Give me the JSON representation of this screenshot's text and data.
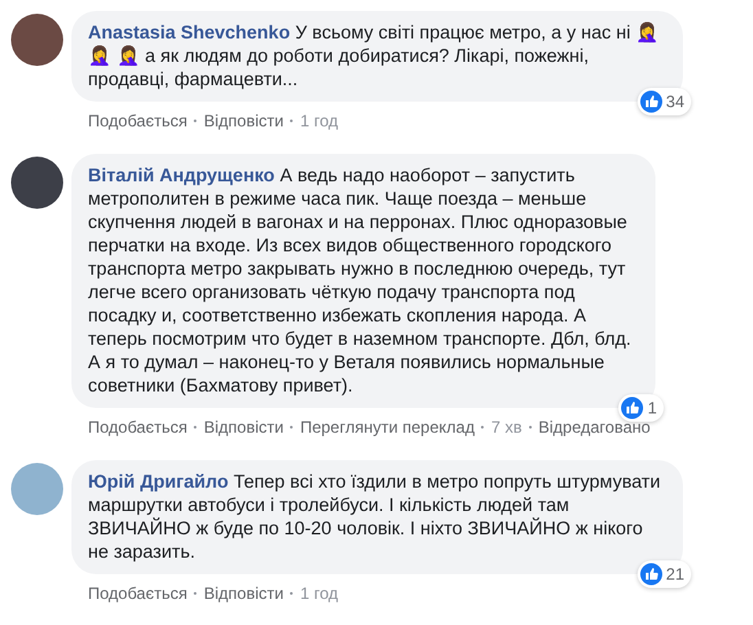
{
  "comments": [
    {
      "author": "Anastasia Shevchenko",
      "text": "У всьому світі працює метро, а у нас ні 🤦‍♀️ 🤦‍♀️ 🤦‍♀️ а як людям до роботи добиратися? Лікарі, пожежні, продавці, фармацевти...",
      "likes": "34",
      "actions": [
        {
          "label": "Подобається",
          "kind": "link"
        },
        {
          "label": "Відповісти",
          "kind": "link"
        },
        {
          "label": "1 год",
          "kind": "time"
        }
      ]
    },
    {
      "author": "Віталій Андрущенко",
      "text": "А ведь надо наоборот – запустить метрополитен в режиме часа пик. Чаще поезда – меньше скупчення людей в вагонах и на перронах. Плюс одноразовые перчатки на входе. Из всех видов общественного городского транспорта метро закрывать нужно в последнюю очередь, тут легче всего организовать чёткую подачу транспорта под посадку и, соответственно избежать скопления народа. А теперь посмотрим что будет в наземном транспорте. Дбл, блд. А я то думал – наконец-то у Веталя появились нормальные советники (Бахматову привет).",
      "likes": "1",
      "actions": [
        {
          "label": "Подобається",
          "kind": "link"
        },
        {
          "label": "Відповісти",
          "kind": "link"
        },
        {
          "label": "Переглянути переклад",
          "kind": "link"
        },
        {
          "label": "7 хв",
          "kind": "time"
        },
        {
          "label": "Відредаговано",
          "kind": "link"
        }
      ]
    },
    {
      "author": "Юрій Дригайло",
      "text": "Тепер всі хто їздили в метро попруть штурмувати маршрутки автобуси і тролейбуси. І кількість людей там ЗВИЧАЙНО ж буде по 10-20 чоловік. І ніхто ЗВИЧАЙНО ж нікого не заразить.",
      "likes": "21",
      "actions": [
        {
          "label": "Подобається",
          "kind": "link"
        },
        {
          "label": "Відповісти",
          "kind": "link"
        },
        {
          "label": "1 год",
          "kind": "time"
        }
      ]
    }
  ]
}
